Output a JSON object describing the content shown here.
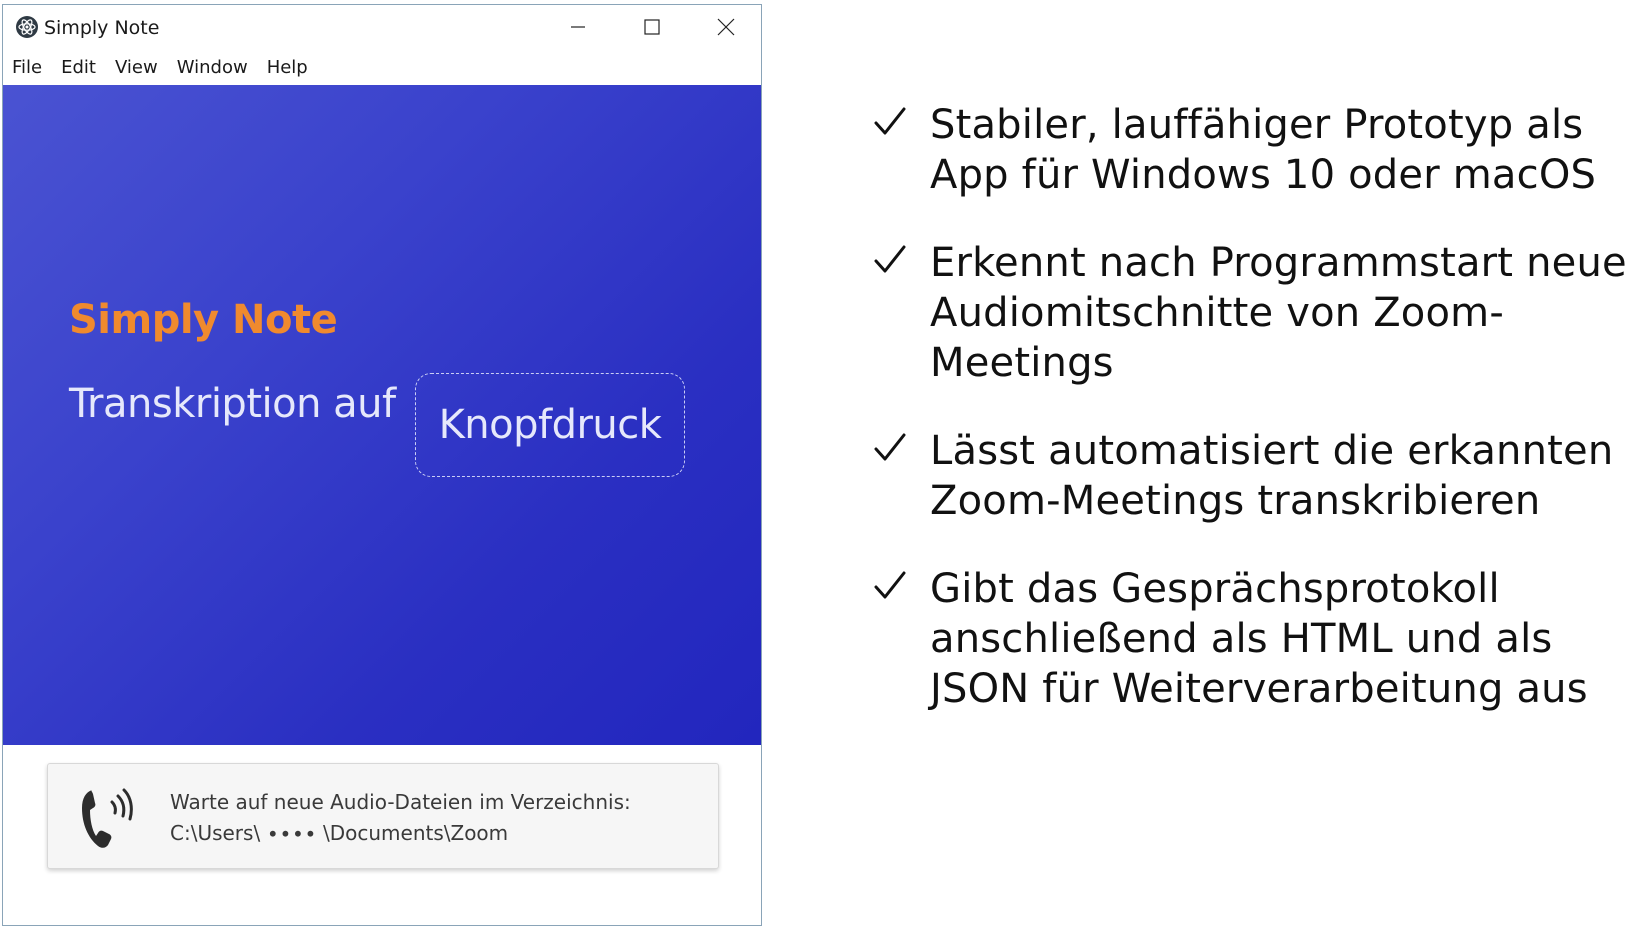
{
  "window": {
    "title": "Simply Note",
    "icon": "electron-atom-icon"
  },
  "menu": {
    "items": [
      {
        "label": "File"
      },
      {
        "label": "Edit"
      },
      {
        "label": "View"
      },
      {
        "label": "Window"
      },
      {
        "label": "Help"
      }
    ]
  },
  "hero": {
    "title": "Simply Note",
    "subtitle": "Transkription auf",
    "button_label": "Knopfdruck",
    "title_color": "#f08a2e",
    "gradient": [
      "#4a53d2",
      "#2226be"
    ]
  },
  "status": {
    "icon": "phone-ringing-icon",
    "line1": "Warte auf neue Audio-Dateien im Verzeichnis:",
    "line2": "C:\\Users\\ ∙∙∙∙ \\Documents\\Zoom"
  },
  "bullets": [
    {
      "icon": "checkmark-icon",
      "text": "Stabiler, lauffähiger Prototyp als App für Windows 10 oder macOS"
    },
    {
      "icon": "checkmark-icon",
      "text": "Erkennt nach Programmstart neue Audiomitschnitte von Zoom-Meetings"
    },
    {
      "icon": "checkmark-icon",
      "text": "Lässt automatisiert die erkannten Zoom-Meetings transkribieren"
    },
    {
      "icon": "checkmark-icon",
      "text": "Gibt das Gesprächsprotokoll anschließend als HTML und als JSON für Weiterverarbeitung aus"
    }
  ]
}
